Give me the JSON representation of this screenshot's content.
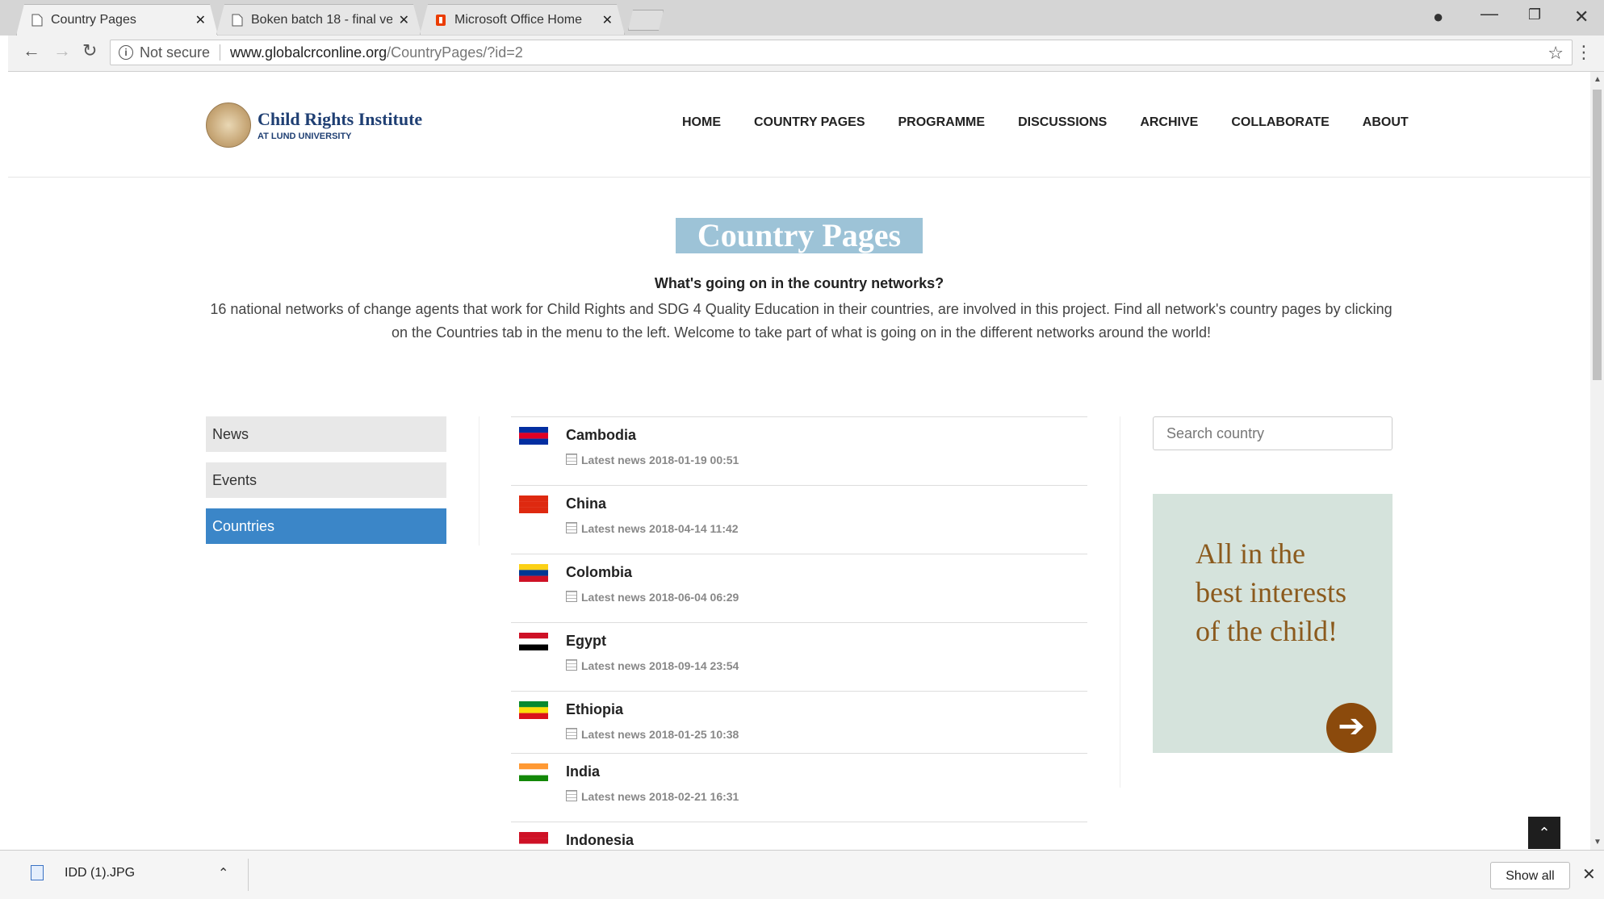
{
  "browser": {
    "tabs": [
      {
        "title": "Country Pages",
        "active": true
      },
      {
        "title": "Boken batch 18 - final ve",
        "active": false
      },
      {
        "title": "Microsoft Office Home",
        "active": false
      }
    ],
    "url_security": "Not secure",
    "url_host": "www.globalcrconline.org",
    "url_path": "/CountryPages/?id=2"
  },
  "site": {
    "logo_name": "Child Rights Institute",
    "logo_sub": "AT LUND UNIVERSITY",
    "nav": [
      "HOME",
      "COUNTRY PAGES",
      "PROGRAMME",
      "DISCUSSIONS",
      "ARCHIVE",
      "COLLABORATE",
      "ABOUT"
    ]
  },
  "main": {
    "title": "Country Pages",
    "subtitle": "What's going on in the country networks?",
    "intro_line1": "16 national networks of change agents that work for Child Rights and SDG 4 Quality Education in their countries, are involved in this project. Find all network's country pages by clicking",
    "intro_line2": "on the Countries tab in the menu to the left. Welcome to take part of what is going on in the different networks around the world!"
  },
  "sidebar": {
    "items": [
      {
        "label": "News",
        "active": false
      },
      {
        "label": "Events",
        "active": false
      },
      {
        "label": "Countries",
        "active": true
      }
    ]
  },
  "countries": [
    {
      "name": "Cambodia",
      "latest": "Latest news 2018-01-19 00:51",
      "flag": [
        "#032ea1",
        "#e00025",
        "#032ea1"
      ]
    },
    {
      "name": "China",
      "latest": "Latest news 2018-04-14 11:42",
      "flag": [
        "#de2910",
        "#de2910",
        "#de2910"
      ]
    },
    {
      "name": "Colombia",
      "latest": "Latest news 2018-06-04 06:29",
      "flag": [
        "#fcd116",
        "#003893",
        "#ce1126"
      ]
    },
    {
      "name": "Egypt",
      "latest": "Latest news 2018-09-14 23:54",
      "flag": [
        "#ce1126",
        "#ffffff",
        "#000000"
      ]
    },
    {
      "name": "Ethiopia",
      "latest": "Latest news 2018-01-25 10:38",
      "flag": [
        "#078930",
        "#fcdd09",
        "#da121a"
      ]
    },
    {
      "name": "India",
      "latest": "Latest news 2018-02-21 16:31",
      "flag": [
        "#ff9933",
        "#ffffff",
        "#138808"
      ]
    },
    {
      "name": "Indonesia",
      "latest": "",
      "flag": [
        "#ce1126",
        "#ce1126",
        "#ffffff"
      ]
    }
  ],
  "search": {
    "placeholder": "Search country"
  },
  "banner": {
    "line1": "All in the",
    "line2": "best interests",
    "line3": "of the child!"
  },
  "downloads": {
    "file": "IDD (1).JPG",
    "show_all": "Show all"
  }
}
